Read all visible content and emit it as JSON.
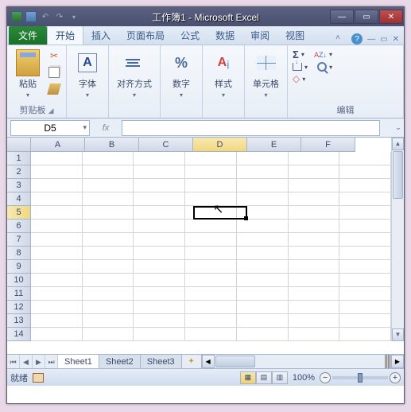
{
  "titlebar": {
    "title": "工作簿1 - Microsoft Excel"
  },
  "tabs": {
    "file": "文件",
    "home": "开始",
    "insert": "插入",
    "layout": "页面布局",
    "formulas": "公式",
    "data": "数据",
    "review": "审阅",
    "view": "视图"
  },
  "ribbon": {
    "clipboard": {
      "paste": "粘贴",
      "label": "剪贴板"
    },
    "font": {
      "btn": "字体"
    },
    "align": {
      "btn": "对齐方式"
    },
    "number": {
      "btn": "数字"
    },
    "styles": {
      "btn": "样式"
    },
    "cells": {
      "btn": "单元格"
    },
    "editing": {
      "label": "编辑"
    }
  },
  "namebox": {
    "value": "D5"
  },
  "fbar": {
    "fx": "fx"
  },
  "cols": [
    "A",
    "B",
    "C",
    "D",
    "E",
    "F"
  ],
  "rows": [
    "1",
    "2",
    "3",
    "4",
    "5",
    "6",
    "7",
    "8",
    "9",
    "10",
    "11",
    "12",
    "13",
    "14"
  ],
  "sheets": {
    "s1": "Sheet1",
    "s2": "Sheet2",
    "s3": "Sheet3"
  },
  "status": {
    "ready": "就绪",
    "zoom": "100%"
  },
  "chart_data": null
}
